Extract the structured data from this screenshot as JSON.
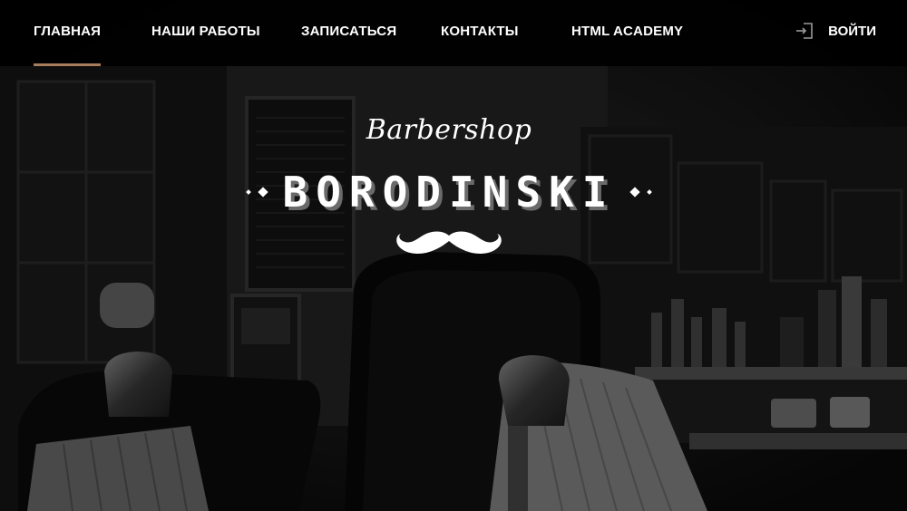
{
  "nav": {
    "items": [
      {
        "label": "ГЛАВНАЯ",
        "active": true
      },
      {
        "label": "НАШИ РАБОТЫ",
        "active": false
      },
      {
        "label": "ЗАПИСАТЬСЯ",
        "active": false
      },
      {
        "label": "КОНТАКТЫ",
        "active": false
      },
      {
        "label": "HTML ACADEMY",
        "active": false
      }
    ],
    "login": {
      "label": "ВОЙТИ",
      "icon": "login-icon"
    },
    "accent_color": "#a77c5a"
  },
  "logo": {
    "script": "Barbershop",
    "name": "BORODINSKI",
    "emblem": "mustache-icon"
  }
}
